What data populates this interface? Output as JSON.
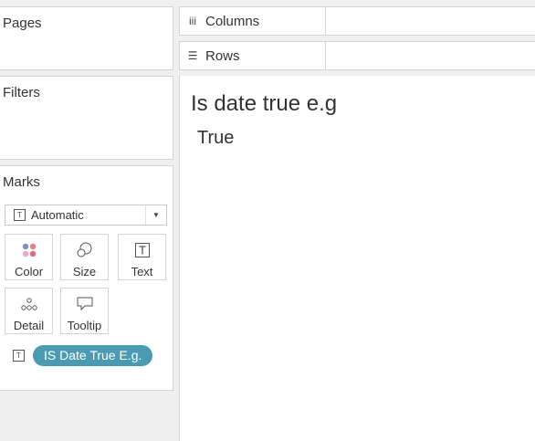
{
  "cards": {
    "pages": "Pages",
    "filters": "Filters",
    "marks": "Marks"
  },
  "shelves": {
    "columns": {
      "icon": "iii",
      "label": "Columns"
    },
    "rows": {
      "icon": "☰",
      "label": "Rows"
    }
  },
  "marks": {
    "type": "Automatic",
    "type_icon": "T",
    "buttons": {
      "color": "Color",
      "size": "Size",
      "text": "Text",
      "detail": "Detail",
      "tooltip": "Tooltip"
    },
    "field": {
      "icon": "T",
      "label": "IS Date True E.g."
    }
  },
  "viz": {
    "title": "Is date true e.g",
    "value": "True"
  },
  "colors": {
    "pill": "#4a9bb2",
    "background": "#f0f0f0"
  }
}
